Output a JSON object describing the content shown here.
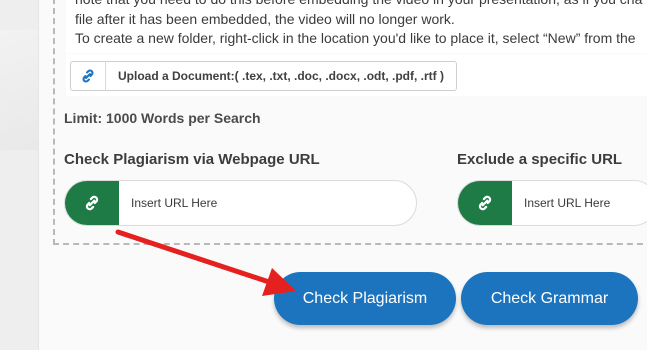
{
  "textarea": {
    "lines": [
      "note that you need to do this before embedding the video in your presentation, as if you cha",
      "file after it has been embedded, the video will no longer work.",
      "To create a new folder, right-click in the location you'd like to place it, select “New” from the"
    ]
  },
  "upload": {
    "label": "Upload a Document:( .tex, .txt, .doc, .docx, .odt, .pdf, .rtf )"
  },
  "limit_text": "Limit: 1000 Words per Search",
  "url_check": {
    "label": "Check Plagiarism via Webpage URL",
    "placeholder": "Insert URL Here"
  },
  "url_exclude": {
    "label": "Exclude a specific URL",
    "placeholder": "Insert URL Here"
  },
  "buttons": {
    "check_plagiarism": "Check Plagiarism",
    "check_grammar": "Check Grammar"
  },
  "colors": {
    "green": "#1e7b46",
    "blue": "#1b74bd",
    "arrow": "#e5211f"
  }
}
